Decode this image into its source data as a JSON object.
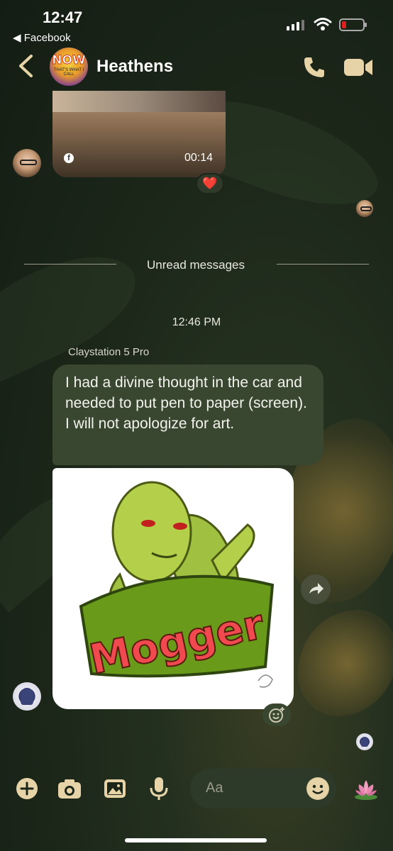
{
  "status_bar": {
    "time": "12:47",
    "back_app": "◀ Facebook"
  },
  "header": {
    "title": "Heathens",
    "avatar_text": "NOW",
    "avatar_sub": "THAT'S WHAT I CALL"
  },
  "video_message": {
    "duration": "00:14",
    "source_icon": "facebook-icon",
    "reaction": "❤️"
  },
  "unread_divider": {
    "label": "Unread messages"
  },
  "timestamp": "12:46 PM",
  "message": {
    "sender": "Claystation 5 Pro",
    "text": "I had a divine thought in the car and needed to put pen to paper (screen). I will not apologize for art.",
    "image": {
      "caption_text": "Mogger"
    }
  },
  "composer": {
    "placeholder": "Aa"
  },
  "colors": {
    "accent": "#e6d4a8",
    "bubble": "#3a4730",
    "background": "#1b2619"
  }
}
